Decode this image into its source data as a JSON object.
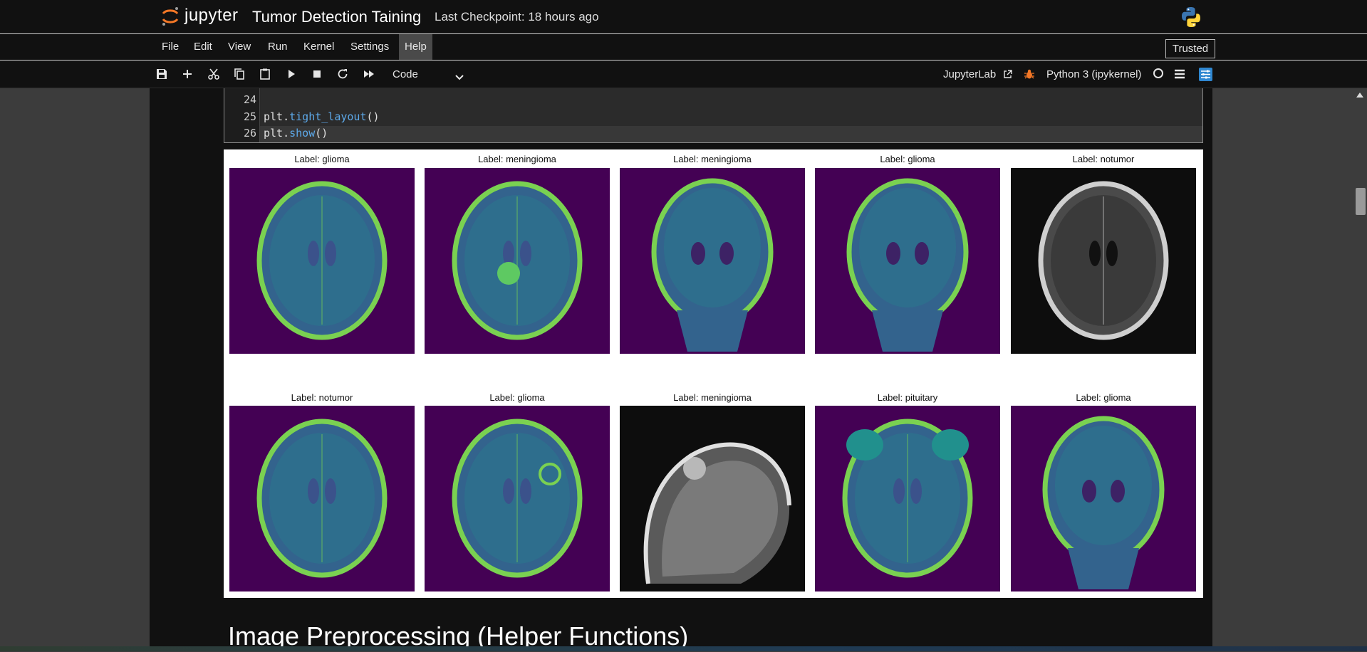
{
  "header": {
    "brand": "jupyter",
    "title": "Tumor Detection Taining",
    "checkpoint": "Last Checkpoint: 18 hours ago"
  },
  "menu": {
    "items": [
      "File",
      "Edit",
      "View",
      "Run",
      "Kernel",
      "Settings",
      "Help"
    ],
    "active": "Help",
    "trusted": "Trusted"
  },
  "toolbar": {
    "icons": [
      "save-icon",
      "add-cell-icon",
      "cut-icon",
      "copy-icon",
      "paste-icon",
      "run-icon",
      "stop-icon",
      "restart-icon",
      "fast-forward-icon"
    ],
    "cell_type": "Code",
    "jupyterlab_link": "JupyterLab",
    "kernel": "Python 3 (ipykernel)",
    "accent": "#2f87d1"
  },
  "code_cell": {
    "line_numbers": [
      "24",
      "25",
      "26"
    ],
    "lines": [
      "",
      "plt.tight_layout()",
      "plt.show()"
    ]
  },
  "output": {
    "panels": [
      {
        "label": "Label: glioma",
        "style": "viridis-axial"
      },
      {
        "label": "Label: meningioma",
        "style": "viridis-axial-mass"
      },
      {
        "label": "Label: meningioma",
        "style": "viridis-coronal"
      },
      {
        "label": "Label: glioma",
        "style": "viridis-coronal"
      },
      {
        "label": "Label: notumor",
        "style": "gray-axial"
      },
      {
        "label": "Label: notumor",
        "style": "viridis-axial"
      },
      {
        "label": "Label: glioma",
        "style": "viridis-axial-ring"
      },
      {
        "label": "Label: meningioma",
        "style": "gray-sagittal"
      },
      {
        "label": "Label: pituitary",
        "style": "viridis-axial-base"
      },
      {
        "label": "Label: glioma",
        "style": "viridis-coronal"
      }
    ]
  },
  "markdown": {
    "heading": "Image Preprocessing (Helper Functions)"
  }
}
